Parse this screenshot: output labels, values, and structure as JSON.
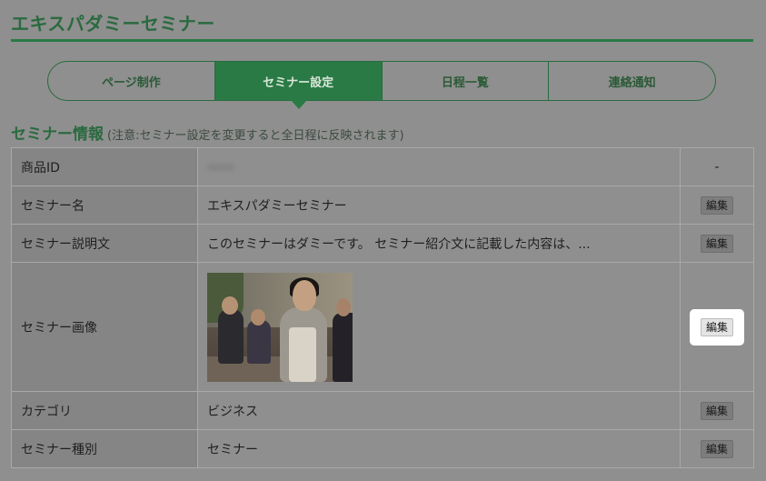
{
  "page": {
    "title": "エキスパダミーセミナー"
  },
  "tabs": [
    {
      "label": "ページ制作",
      "active": false
    },
    {
      "label": "セミナー設定",
      "active": true
    },
    {
      "label": "日程一覧",
      "active": false
    },
    {
      "label": "連絡通知",
      "active": false
    }
  ],
  "section": {
    "heading": "セミナー情報",
    "note": "(注意:セミナー設定を変更すると全日程に反映されます)"
  },
  "rows": [
    {
      "label": "商品ID",
      "value": "",
      "action": "-"
    },
    {
      "label": "セミナー名",
      "value": "エキスパダミーセミナー",
      "action": "編集"
    },
    {
      "label": "セミナー説明文",
      "value": "このセミナーはダミーです。 セミナー紹介文に記載した内容は、...",
      "action": "編集"
    },
    {
      "label": "セミナー画像",
      "value": "",
      "action": "編集"
    },
    {
      "label": "カテゴリ",
      "value": "ビジネス",
      "action": "編集"
    },
    {
      "label": "セミナー種別",
      "value": "セミナー",
      "action": "編集"
    }
  ],
  "colors": {
    "brand_green": "#2a7a45",
    "overlay_gray": "#8f8f8f",
    "highlight": "#ffffff"
  }
}
